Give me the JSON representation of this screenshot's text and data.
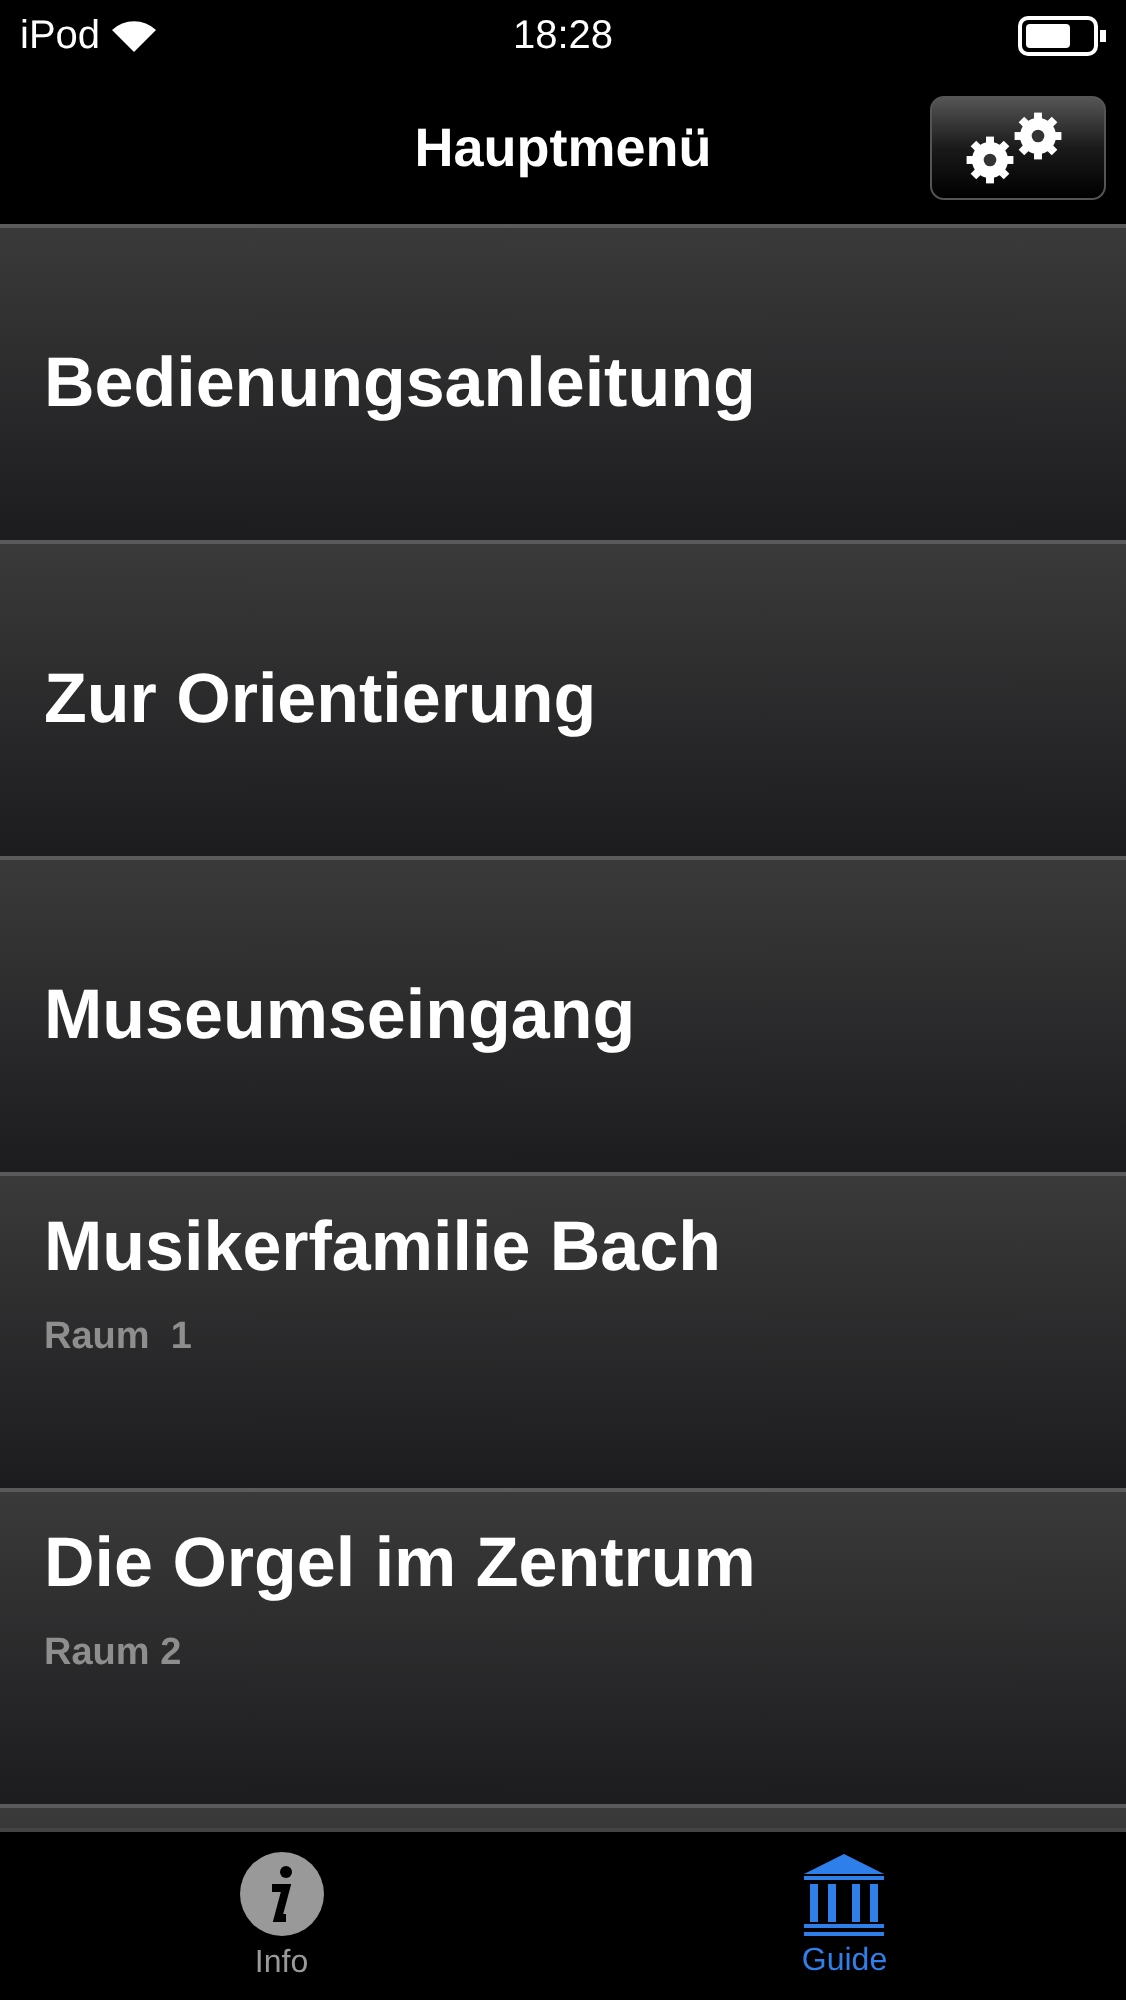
{
  "status_bar": {
    "carrier": "iPod",
    "time": "18:28"
  },
  "nav_bar": {
    "title": "Hauptmenü"
  },
  "menu_items": [
    {
      "title": "Bedienungsanleitung"
    },
    {
      "title": "Zur Orientierung"
    },
    {
      "title": "Museumseingang"
    },
    {
      "title": "Musikerfamilie Bach",
      "subtitle": "Raum  1"
    },
    {
      "title": "Die Orgel im Zentrum",
      "subtitle": "Raum 2"
    }
  ],
  "tab_bar": [
    {
      "label": "Info",
      "kind": "info",
      "selected": false
    },
    {
      "label": "Guide",
      "kind": "museum",
      "selected": true
    }
  ]
}
